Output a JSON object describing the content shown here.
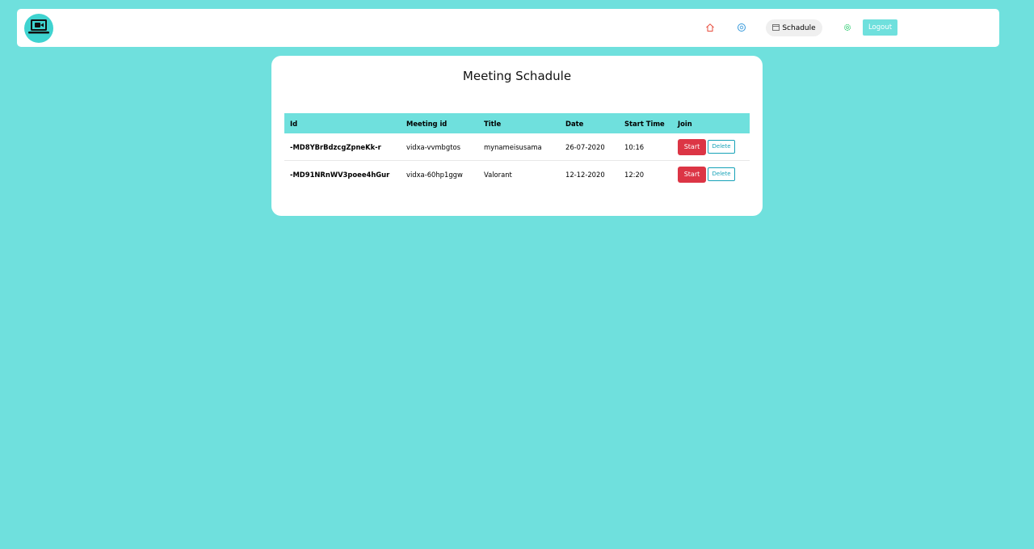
{
  "nav": {
    "logo_icon": "video-laptop-icon",
    "home_icon": "home-icon",
    "meet_icon": "chat-icon",
    "schedule_icon": "calendar-icon",
    "schedule_label": "Schadule",
    "settings_icon": "gear-icon",
    "logout_label": "Logout"
  },
  "page": {
    "title": "Meeting Schadule"
  },
  "table": {
    "headers": [
      "Id",
      "Meeting id",
      "Title",
      "Date",
      "Start Time",
      "Join"
    ],
    "rows": [
      {
        "id": "-MD8YBrBdzcgZpneKk-r",
        "meeting_id": "vidxa-vvmbgtos",
        "title": "mynameisusama",
        "date": "26-07-2020",
        "start_time": "10:16",
        "start_label": "Start",
        "delete_label": "Delete"
      },
      {
        "id": "-MD91NRnWV3poee4hGur",
        "meeting_id": "vidxa-60hp1ggw",
        "title": "Valorant",
        "date": "12-12-2020",
        "start_time": "12:20",
        "start_label": "Start",
        "delete_label": "Delete"
      }
    ]
  },
  "colors": {
    "background": "#6fe0dd",
    "start_button": "#dc3545",
    "delete_button": "#17a2b8",
    "home_icon": "#e74c3c",
    "chat_icon": "#3498db",
    "settings_icon": "#2ecc71"
  }
}
